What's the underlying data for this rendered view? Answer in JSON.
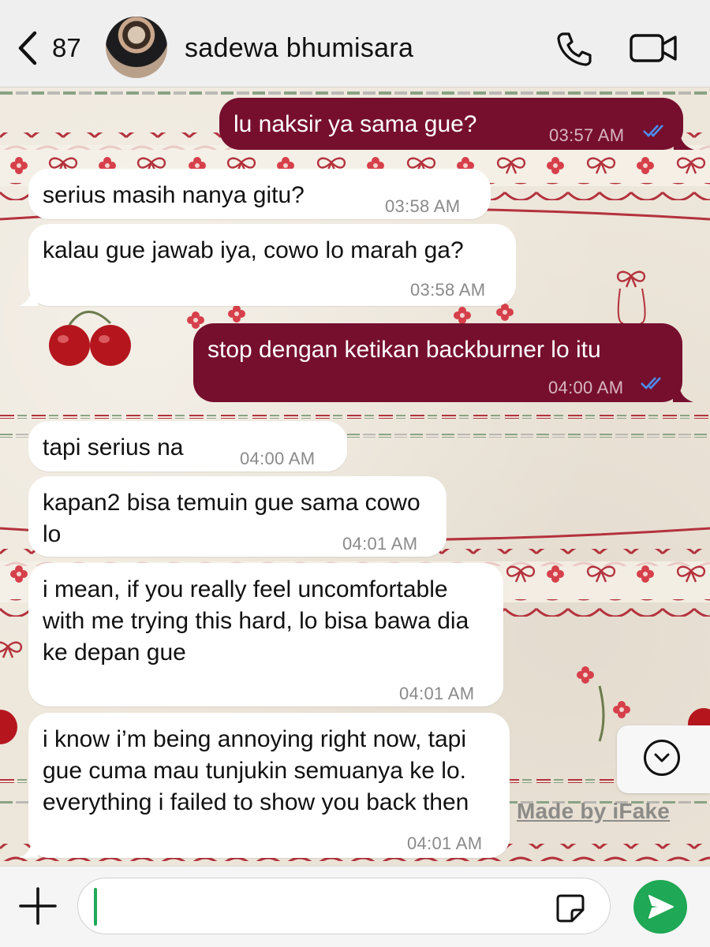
{
  "header": {
    "unread_count": "87",
    "contact_name": "sadewa bhumisara"
  },
  "messages": [
    {
      "direction": "outgoing",
      "text": "lu naksir ya sama gue?",
      "time": "03:57 AM",
      "status": "read"
    },
    {
      "direction": "incoming",
      "text": "serius masih nanya gitu?",
      "time": "03:58 AM"
    },
    {
      "direction": "incoming",
      "text": "kalau gue jawab iya, cowo lo marah ga?",
      "time": "03:58 AM"
    },
    {
      "direction": "outgoing",
      "text": "stop dengan ketikan backburner lo itu",
      "time": "04:00 AM",
      "status": "read"
    },
    {
      "direction": "incoming",
      "text": "tapi serius na",
      "time": "04:00 AM"
    },
    {
      "direction": "incoming",
      "text": "kapan2 bisa temuin gue sama cowo lo",
      "time": "04:01 AM"
    },
    {
      "direction": "incoming",
      "text": "i mean, if you really feel uncomfortable with me trying this hard, lo bisa bawa dia ke depan gue",
      "time": "04:01 AM"
    },
    {
      "direction": "incoming",
      "text": "i know i’m being annoying right now, tapi gue cuma mau tunjukin semuanya ke lo. everything i failed to show you back then",
      "time": "04:01 AM"
    }
  ],
  "watermark": "Made by iFake",
  "composer": {
    "text": ""
  },
  "colors": {
    "outgoing_bubble": "#760f2e",
    "incoming_bubble": "#ffffff",
    "send_button": "#1fa855",
    "read_ticks": "#4a8ef0"
  },
  "icons": [
    "back-chevron-icon",
    "phone-icon",
    "video-camera-icon",
    "chevron-down-icon",
    "plus-icon",
    "sticker-icon",
    "send-arrow-icon"
  ]
}
